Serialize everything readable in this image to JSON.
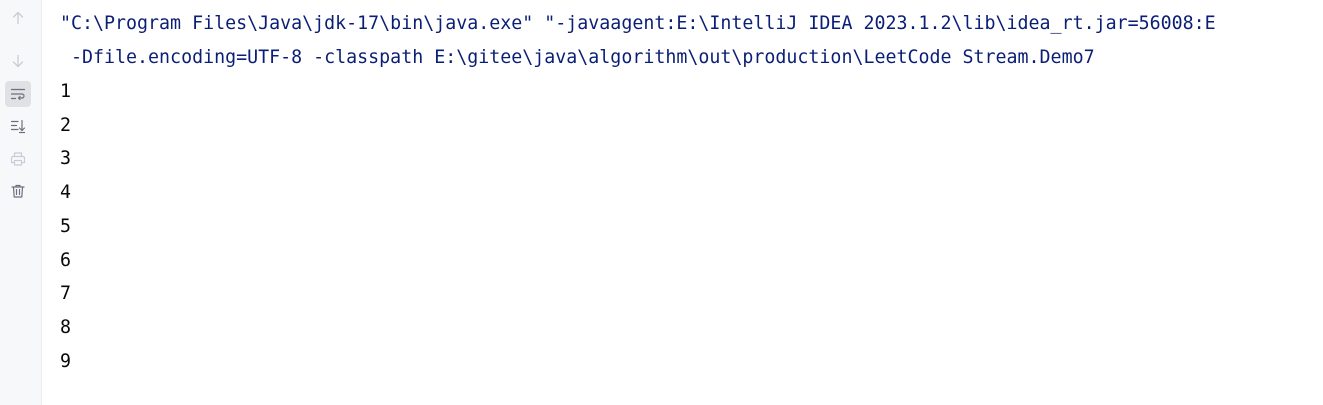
{
  "toolbar": {
    "buttons": [
      {
        "name": "up-arrow-icon",
        "enabled": false
      },
      {
        "name": "down-arrow-icon",
        "enabled": false
      },
      {
        "name": "soft-wrap-icon",
        "enabled": true,
        "active": true
      },
      {
        "name": "scroll-to-end-icon",
        "enabled": true
      },
      {
        "name": "print-icon",
        "enabled": false
      },
      {
        "name": "trash-icon",
        "enabled": true
      }
    ]
  },
  "console": {
    "command_line_1": "\"C:\\Program Files\\Java\\jdk-17\\bin\\java.exe\" \"-javaagent:E:\\IntelliJ IDEA 2023.1.2\\lib\\idea_rt.jar=56008:E",
    "command_line_2": " -Dfile.encoding=UTF-8 -classpath E:\\gitee\\java\\algorithm\\out\\production\\LeetCode Stream.Demo7",
    "output": [
      "1",
      "2",
      "3",
      "4",
      "5",
      "6",
      "7",
      "8",
      "9"
    ]
  },
  "colors": {
    "command_text": "#0a1e76",
    "output_text": "#080808",
    "toolbar_bg": "#f7f8fa",
    "icon_enabled": "#6c707e",
    "icon_disabled": "#c9ccd6"
  }
}
